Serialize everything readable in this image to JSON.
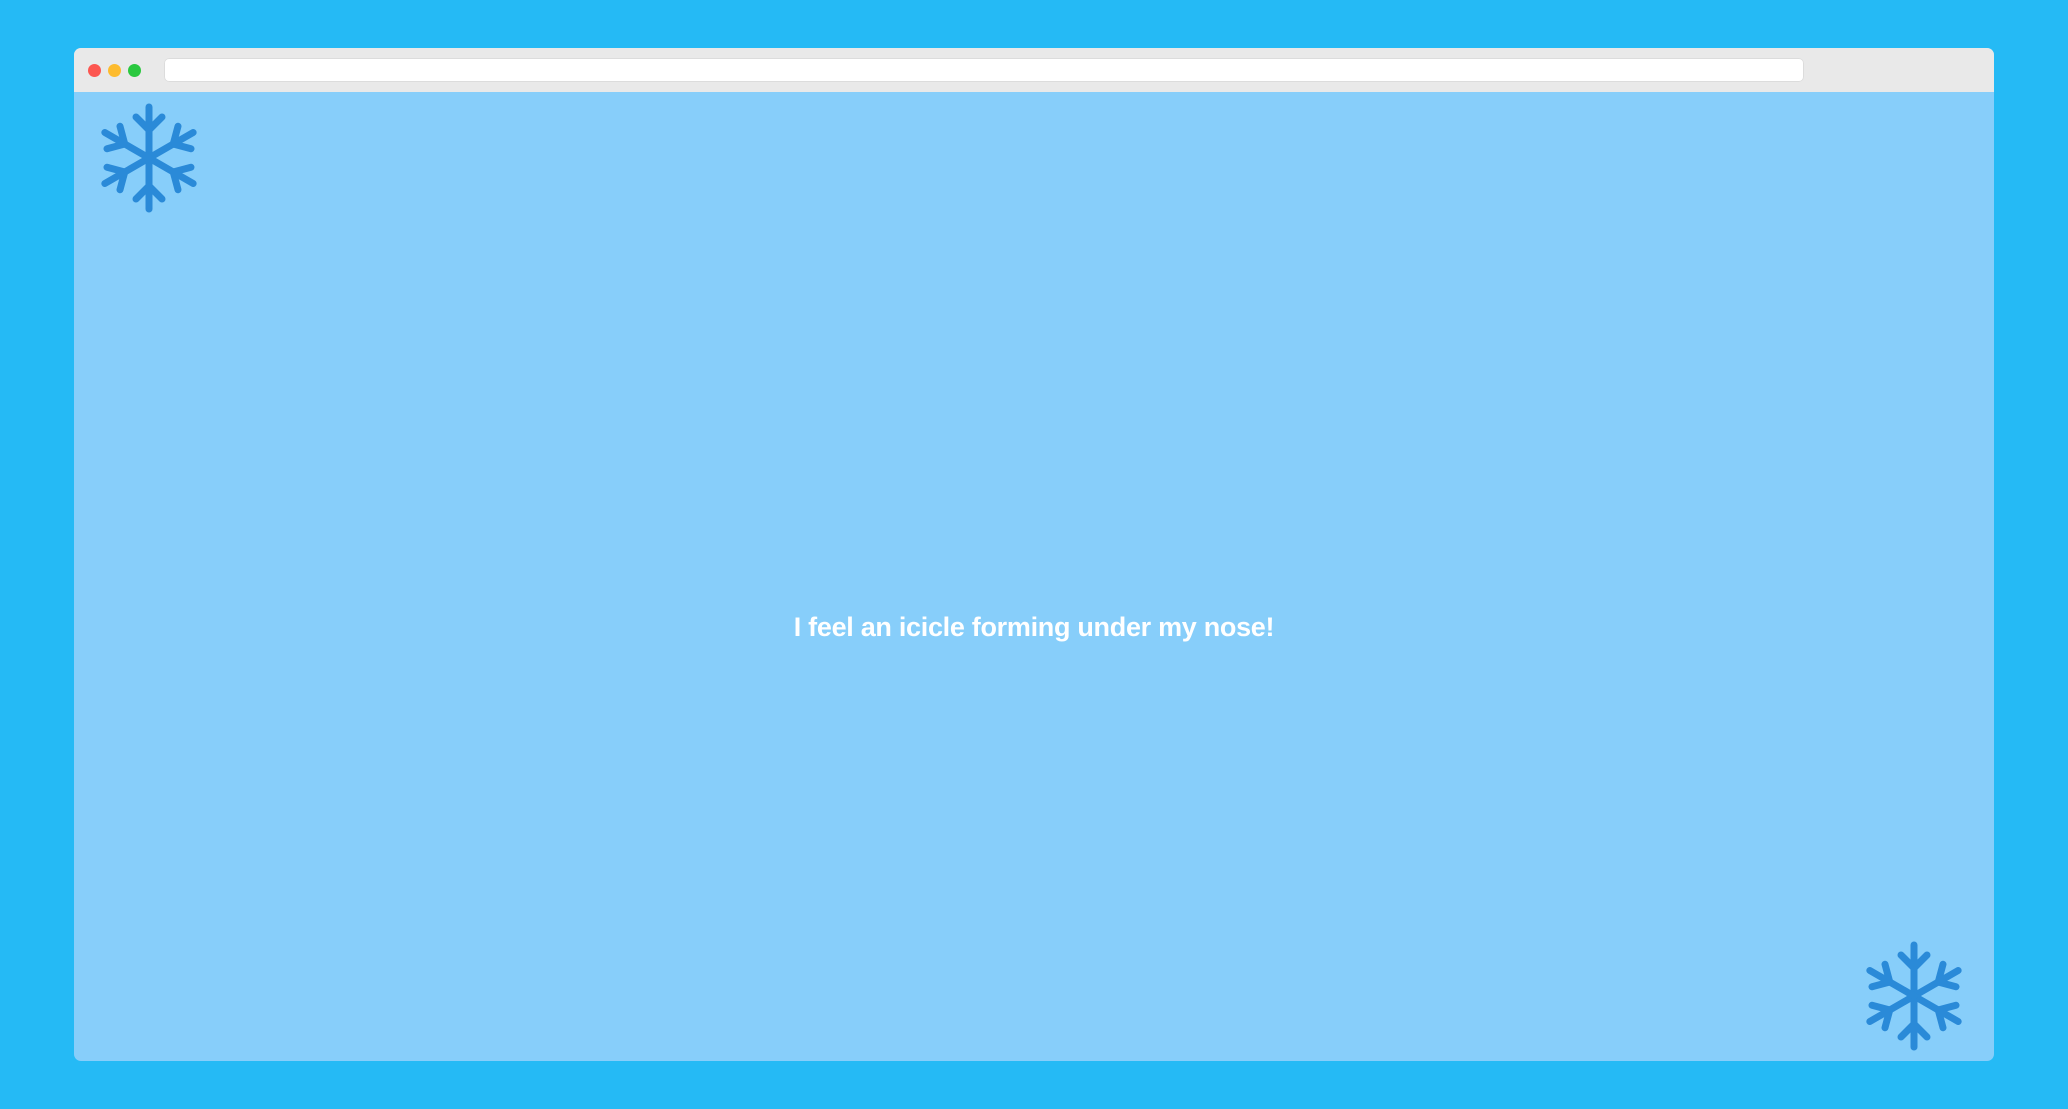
{
  "window": {
    "controls": [
      "close",
      "minimize",
      "maximize"
    ],
    "address_bar": {
      "value": ""
    }
  },
  "content": {
    "message": "I feel an icicle forming under my nose!",
    "decorations": [
      "snowflake-icon",
      "snowflake-icon"
    ]
  },
  "colors": {
    "background": "#25baf5",
    "page": "#87cefa",
    "snowflake": "#2a8ad8",
    "text": "#ffffff",
    "close": "#fc5650",
    "minimize": "#fdbb2e",
    "maximize": "#2ac83f"
  }
}
